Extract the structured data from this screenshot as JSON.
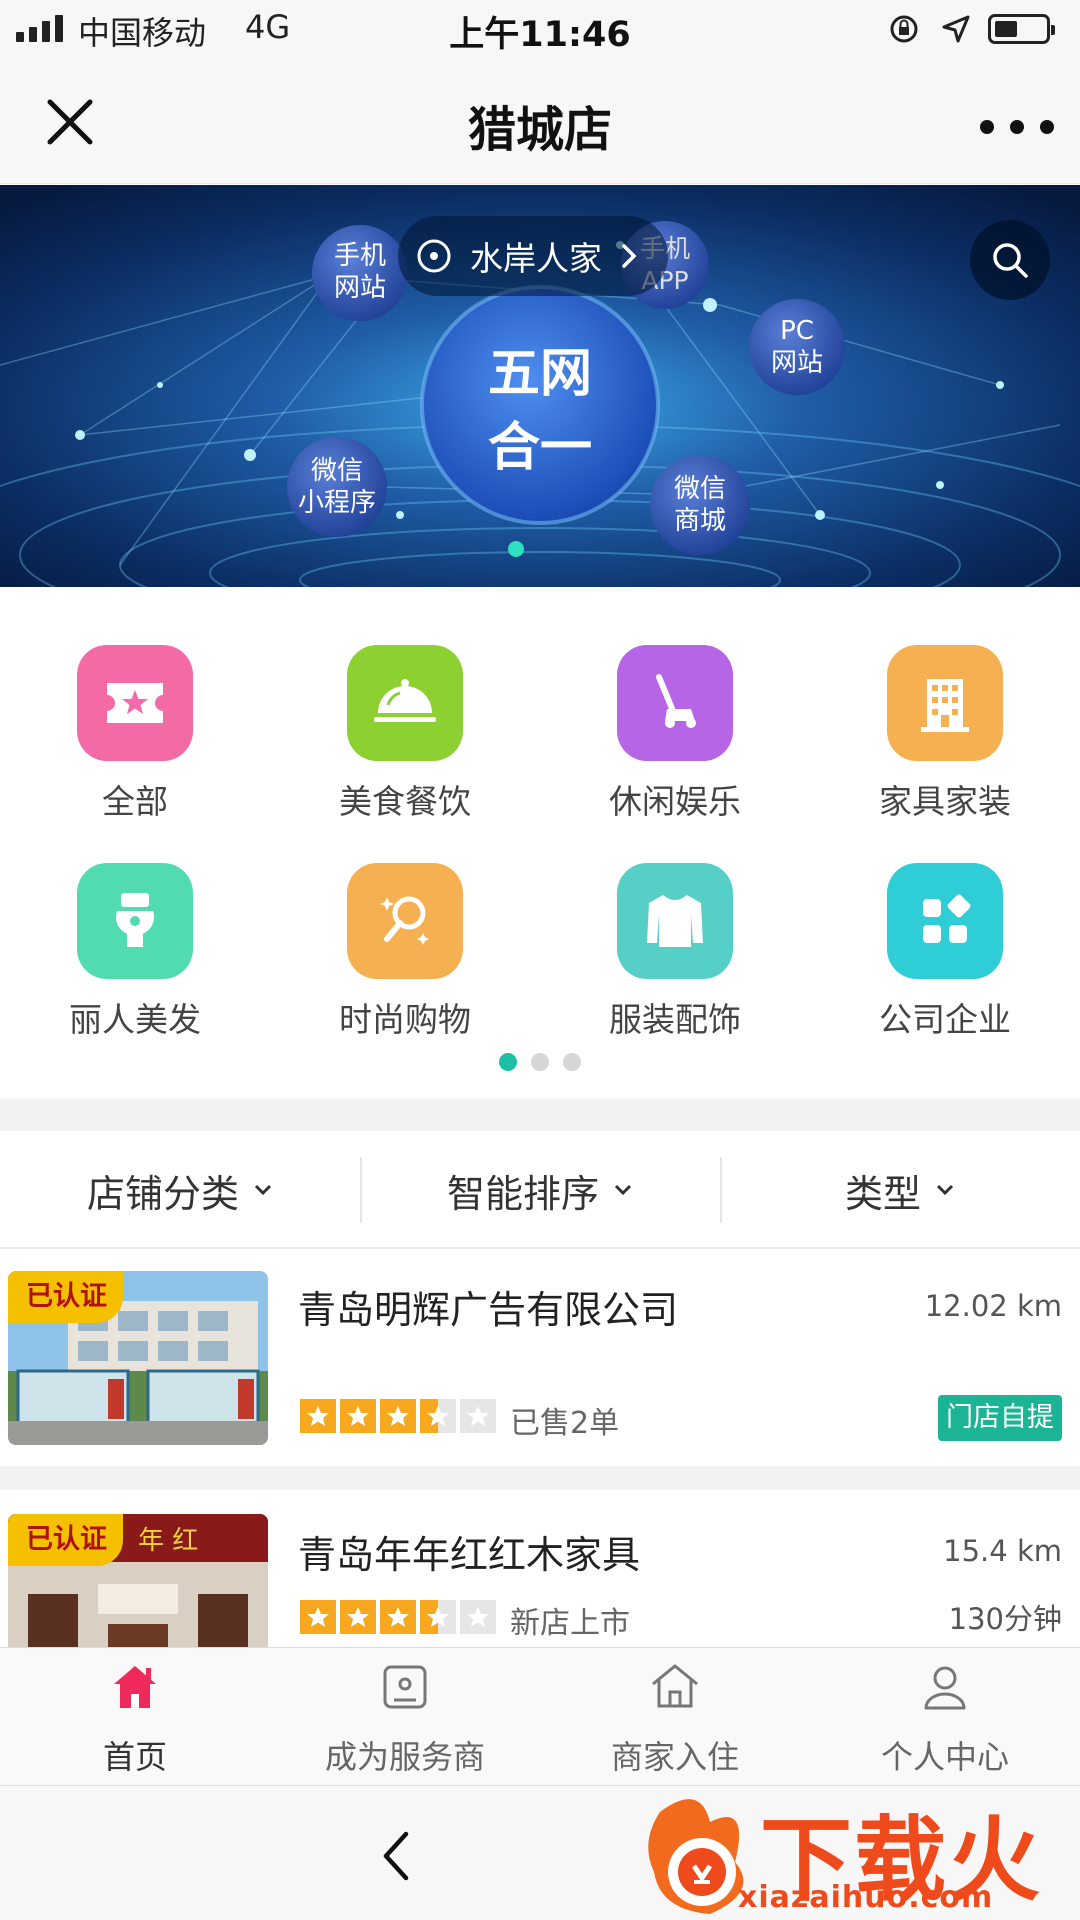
{
  "status_bar": {
    "carrier": "中国移动",
    "network": "4G",
    "time": "上午11:46"
  },
  "nav": {
    "title": "猎城店"
  },
  "banner": {
    "location": "水岸人家",
    "center_line1": "五网",
    "center_line2": "合一",
    "bubbles": [
      {
        "line1": "手机",
        "line2": "网站"
      },
      {
        "line1": "手机",
        "line2": "APP"
      },
      {
        "line1": "PC",
        "line2": "网站"
      },
      {
        "line1": "微信",
        "line2": "小程序"
      },
      {
        "line1": "微信",
        "line2": "商城"
      }
    ]
  },
  "categories": [
    {
      "label": "全部",
      "icon": "ticket-star-icon",
      "color": "#f46aa6"
    },
    {
      "label": "美食餐饮",
      "icon": "food-dome-icon",
      "color": "#8cd032"
    },
    {
      "label": "休闲娱乐",
      "icon": "lawnmower-icon",
      "color": "#b565e6"
    },
    {
      "label": "家具家装",
      "icon": "building-icon",
      "color": "#f5b151"
    },
    {
      "label": "丽人美发",
      "icon": "toilet-icon",
      "color": "#52dbb0"
    },
    {
      "label": "时尚购物",
      "icon": "mirror-sparkle-icon",
      "color": "#f5b151"
    },
    {
      "label": "服装配饰",
      "icon": "sweater-icon",
      "color": "#56cfc6"
    },
    {
      "label": "公司企业",
      "icon": "apps-grid-icon",
      "color": "#2fcdd6"
    }
  ],
  "category_pager": {
    "pages": 3,
    "active": 1
  },
  "filters": [
    {
      "label": "店铺分类"
    },
    {
      "label": "智能排序"
    },
    {
      "label": "类型"
    }
  ],
  "shops": [
    {
      "badge": "已认证",
      "name": "青岛明辉广告有限公司",
      "distance": "12.02 km",
      "rating": 3.5,
      "sub": "已售2单",
      "tag": "门店自提"
    },
    {
      "badge": "已认证",
      "name": "青岛年年红红木家具",
      "distance": "15.4 km",
      "rating": 3.5,
      "sub": "新店上市",
      "time": "130分钟",
      "sign_text": "年 红"
    }
  ],
  "tabbar": [
    {
      "label": "首页",
      "icon": "home-icon",
      "active": true,
      "active_color": "#ee2a5a"
    },
    {
      "label": "成为服务商",
      "icon": "service-provider-icon"
    },
    {
      "label": "商家入住",
      "icon": "merchant-house-icon"
    },
    {
      "label": "个人中心",
      "icon": "person-icon"
    }
  ],
  "watermark": {
    "text": "下载火",
    "url": "xiazaihuo.com"
  }
}
